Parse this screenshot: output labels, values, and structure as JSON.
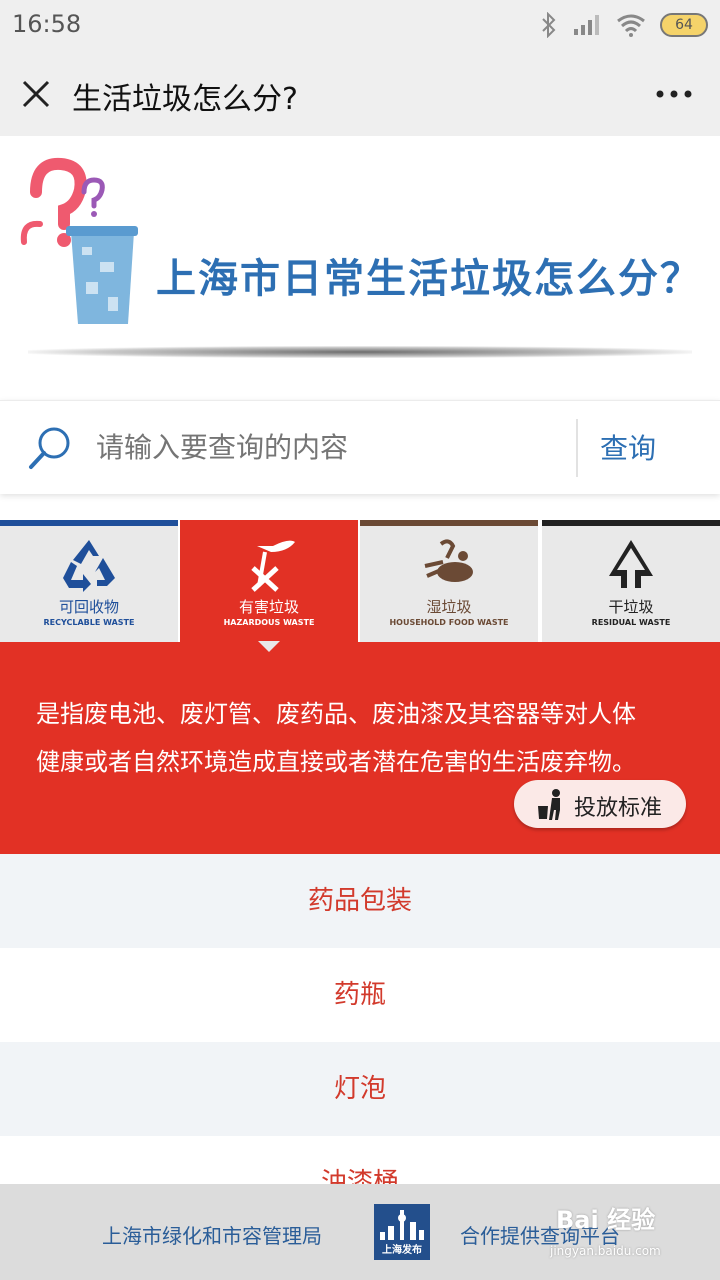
{
  "status": {
    "time": "16:58",
    "battery": "64"
  },
  "titlebar": {
    "title": "生活垃圾怎么分?"
  },
  "banner": {
    "title": "上海市日常生活垃圾怎么分？"
  },
  "search": {
    "placeholder": "请输入要查询的内容",
    "button": "查询"
  },
  "tabs": [
    {
      "zh": "可回收物",
      "en": "RECYCLABLE WASTE",
      "color": "#1f4f9a",
      "icon": "recycle-icon"
    },
    {
      "zh": "有害垃圾",
      "en": "HAZARDOUS WASTE",
      "color": "#e23125",
      "icon": "hazard-icon"
    },
    {
      "zh": "湿垃圾",
      "en": "HOUSEHOLD FOOD WASTE",
      "color": "#6b4a35",
      "icon": "food-waste-icon"
    },
    {
      "zh": "干垃圾",
      "en": "RESIDUAL WASTE",
      "color": "#222222",
      "icon": "residual-icon"
    }
  ],
  "description": {
    "line1": "是指废电池、废灯管、废药品、废油漆及其容器等对人体",
    "line2": "健康或者自然环境造成直接或者潜在危害的生活废弃物。",
    "standard_button": "投放标准"
  },
  "items": [
    "药品包装",
    "药瓶",
    "灯泡",
    "油漆桶"
  ],
  "footer": {
    "left": "上海市绿化和市容管理局",
    "logo_text": "上海发布",
    "right": "合作提供查询平台",
    "watermark": "Bai 经验",
    "watermark_url": "jingyan.baidu.com"
  }
}
